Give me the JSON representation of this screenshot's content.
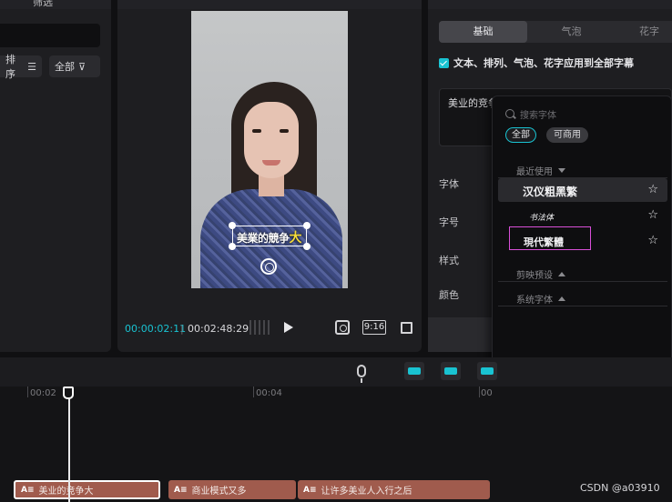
{
  "left_panel": {
    "title": "筛选",
    "sort_label": "排序",
    "all_label": "全部"
  },
  "player": {
    "subtitle_main": "美業的競争",
    "subtitle_highlight": "大",
    "time_current": "00:00:02:11",
    "time_total": "00:02:48:29",
    "ratio_label": "9:16"
  },
  "right_panel": {
    "tabs": [
      "基础",
      "气泡",
      "花字"
    ],
    "apply_all_label": "文本、排列、气泡、花字应用到全部字幕",
    "text_value": "美业的竞争",
    "prop_labels": [
      "字体",
      "字号",
      "样式",
      "颜色"
    ]
  },
  "font_dropdown": {
    "search_placeholder": "搜索字体",
    "filter_all": "全部",
    "filter_commercial": "可商用",
    "recent_header": "最近使用",
    "fonts": [
      {
        "name": "汉仪粗黑繁",
        "selected": true
      },
      {
        "name": "书法体",
        "selected": false
      },
      {
        "name": "現代繁體",
        "selected": false
      }
    ],
    "preset_header": "剪映预设",
    "system_header": "系统字体"
  },
  "timeline": {
    "ruler": [
      "00:02",
      "00:04",
      "00"
    ],
    "clips": [
      {
        "tag": "A≡",
        "label": "美业的竞争大"
      },
      {
        "tag": "A≡",
        "label": "商业模式又多"
      },
      {
        "tag": "A≡",
        "label": "让许多美业人入行之后"
      }
    ]
  },
  "watermark": "CSDN @a03910",
  "colors": {
    "accent": "#19c3d2",
    "clip": "#a05b4d",
    "highlight_box": "#d84fd8",
    "subtitle_highlight": "#f5dc3a"
  }
}
